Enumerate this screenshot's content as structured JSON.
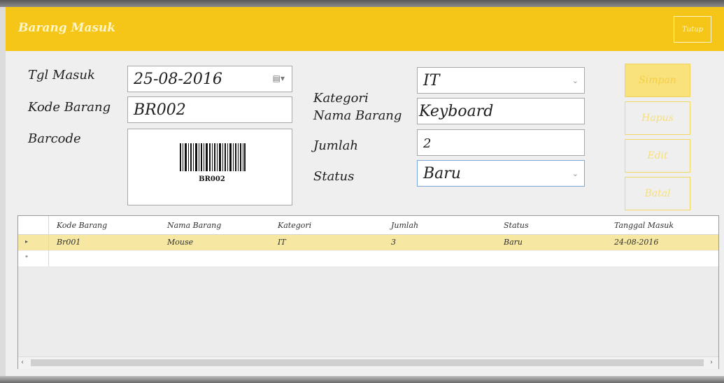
{
  "window": {
    "title": "Barang Masuk",
    "close_label": "Tutup"
  },
  "form": {
    "tgl_masuk_label": "Tgl Masuk",
    "tgl_masuk_value": "25-08-2016",
    "kode_barang_label": "Kode Barang",
    "kode_barang_value": "BR002",
    "barcode_label": "Barcode",
    "barcode_text": "BR002",
    "kategori_label": "Kategori",
    "kategori_value": "IT",
    "nama_barang_label": "Nama Barang",
    "nama_barang_value": "Keyboard",
    "jumlah_label": "Jumlah",
    "jumlah_value": "2",
    "status_label": "Status",
    "status_value": "Baru"
  },
  "buttons": {
    "simpan": "Simpan",
    "hapus": "Hapus",
    "edit": "Edit",
    "batal": "Batal"
  },
  "grid": {
    "columns": [
      "Kode Barang",
      "Nama Barang",
      "Kategori",
      "Jumlah",
      "Status",
      "Tanggal Masuk"
    ],
    "rows": [
      [
        "Br001",
        "Mouse",
        "IT",
        "3",
        "Baru",
        "24-08-2016"
      ]
    ],
    "row_marker": "▸",
    "new_row_marker": "*"
  },
  "icons": {
    "calendar": "calendar-icon",
    "dropdown": "chevron-down-icon"
  },
  "colors": {
    "accent": "#f5c518",
    "selected_row": "#f6e7a3"
  }
}
